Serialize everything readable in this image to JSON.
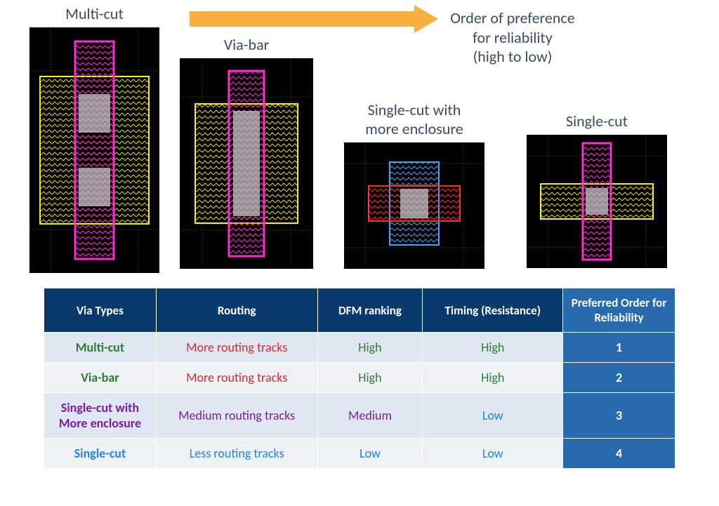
{
  "arrow_caption_line1": "Order of preference",
  "arrow_caption_line2": "for reliability",
  "arrow_caption_line3": "(high to low)",
  "panels": {
    "multicut": {
      "title": "Multi-cut"
    },
    "viabar": {
      "title": "Via-bar"
    },
    "enclose": {
      "title_line1": "Single-cut with",
      "title_line2": "more enclosure"
    },
    "single": {
      "title": "Single-cut"
    }
  },
  "table": {
    "headers": [
      "Via Types",
      "Routing",
      "DFM ranking",
      "Timing (Resistance)",
      "Preferred Order for Reliability"
    ],
    "rows": [
      {
        "type": "Multi-cut",
        "type_cls": "txt-green",
        "routing": "More routing tracks",
        "routing_cls": "txt-red",
        "dfm": "High",
        "dfm_cls": "txt-green",
        "timing": "High",
        "timing_cls": "txt-green",
        "order": "1"
      },
      {
        "type": "Via-bar",
        "type_cls": "txt-green",
        "routing": "More routing tracks",
        "routing_cls": "txt-red",
        "dfm": "High",
        "dfm_cls": "txt-green",
        "timing": "High",
        "timing_cls": "txt-green",
        "order": "2"
      },
      {
        "type": "Single-cut with More enclosure",
        "type_cls": "txt-purple",
        "routing": "Medium routing tracks",
        "routing_cls": "txt-purple",
        "dfm": "Medium",
        "dfm_cls": "txt-purple",
        "timing": "Low",
        "timing_cls": "txt-blue",
        "order": "3"
      },
      {
        "type": "Single-cut",
        "type_cls": "txt-blue",
        "routing": "Less routing tracks",
        "routing_cls": "txt-blue",
        "dfm": "Low",
        "dfm_cls": "txt-blue",
        "timing": "Low",
        "timing_cls": "txt-blue",
        "order": "4"
      }
    ]
  }
}
